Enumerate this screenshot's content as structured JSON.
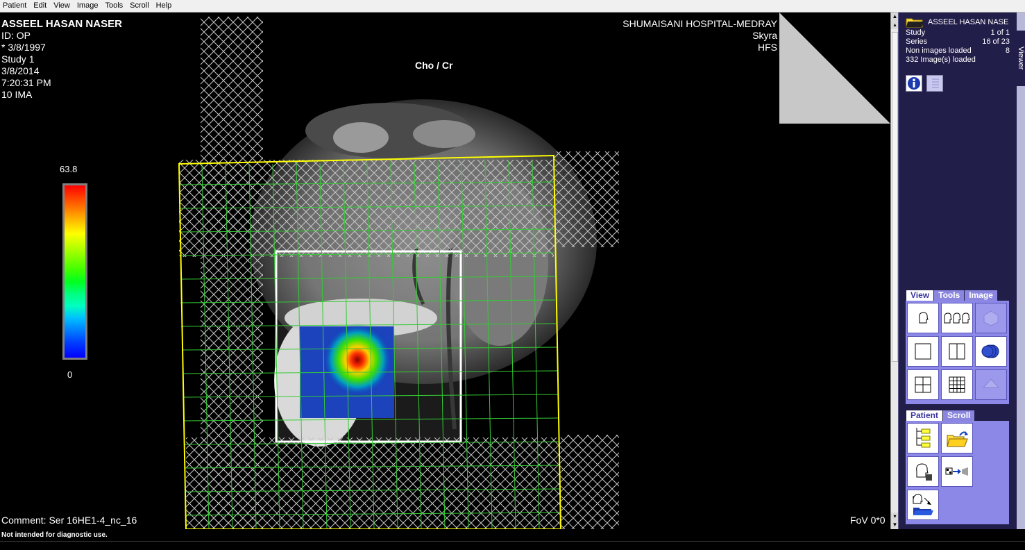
{
  "menu": [
    "Patient",
    "Edit",
    "View",
    "Image",
    "Tools",
    "Scroll",
    "Help"
  ],
  "overlay": {
    "patient_name": "ASSEEL HASAN NASER",
    "id": "ID: OP",
    "dob": "* 3/8/1997",
    "study": "Study 1",
    "date": "3/8/2014",
    "time": "7:20:31 PM",
    "ima": "10 IMA",
    "hospital": "SHUMAISANI HOSPITAL-MEDRAY",
    "scanner": "Skyra",
    "position": "HFS",
    "map_title": "Cho / Cr",
    "colorbar_max": "63.8",
    "colorbar_min": "0",
    "comment": "Comment: Ser 16HE1-4_nc_16",
    "fov": "FoV 0*0"
  },
  "info_panel": {
    "patient": "ASSEEL HASAN NASE",
    "study_label": "Study",
    "study_value": "1 of 1",
    "series_label": "Series",
    "series_value": "16 of 23",
    "non_images_label": "Non images loaded",
    "non_images_value": "8",
    "images_loaded": "332 Image(s) loaded"
  },
  "side_tab": "Viewer",
  "tool_tabs": [
    "View",
    "Tools",
    "Image"
  ],
  "patient_tabs": [
    "Patient",
    "Scroll"
  ],
  "status": "Not intended for diagnostic use.",
  "colors": {
    "panel_bg": "#221e4a",
    "toolbox_bg": "#8c88e8",
    "grid_green": "#33cc33",
    "voi_yellow": "#ffff00"
  }
}
